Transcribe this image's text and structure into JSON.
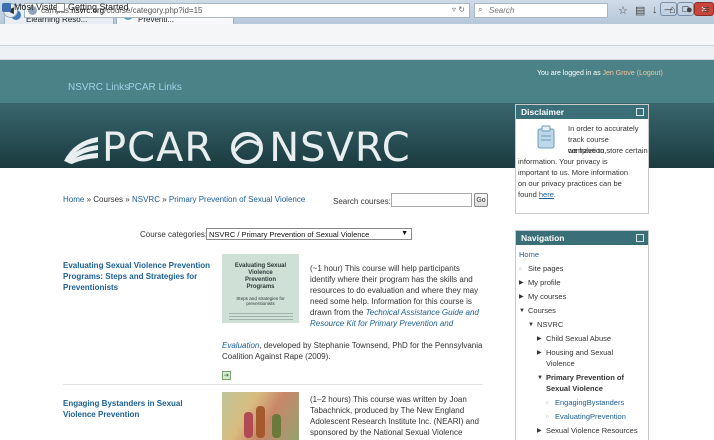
{
  "browser": {
    "tabs": [
      {
        "title": "Browse the Elearning Reso...",
        "close": "×"
      },
      {
        "title": "Campus: Primary Preventi...",
        "close": "×"
      }
    ],
    "new_tab": "+",
    "url_prefix": "campus.",
    "url_host": "nsvrc.org",
    "url_path": "/course/category.php?id=15",
    "search_placeholder": "Search",
    "bookmarks": [
      "Most Visited",
      "Getting Started"
    ]
  },
  "site": {
    "top_links": [
      "NSVRC Links",
      "PCAR Links"
    ],
    "logged_in_prefix": "You are logged in as ",
    "user": "Jen Grove",
    "logout": "(Logout)",
    "logo_left": "PCAR",
    "logo_right": "NSVRC"
  },
  "breadcrumb": [
    "Home",
    "Courses",
    "NSVRC",
    "Primary Prevention of Sexual Violence"
  ],
  "breadcrumb_sep": "»",
  "search": {
    "label": "Search courses:",
    "go": "Go"
  },
  "category": {
    "label": "Course categories:",
    "selected": "NSVRC / Primary Prevention of Sexual Violence"
  },
  "courses": [
    {
      "title": "Evaluating Sexual Violence Prevention Programs: Steps and Strategies for Preventionists",
      "thumb_title": "Evaluating Sexual Violence Prevention Programs",
      "thumb_subtitle": "Steps and strategies for preventionists",
      "desc_lines": [
        "(~1 hour)  This course will help participants",
        "identify where their program has the skills and",
        "resources to do evaluation and where they may",
        "need some help.  Information for this course is",
        "drawn from the"
      ],
      "desc_link1": "Technical Assistance Guide and",
      "desc_link2": "Resource Kit for Primary Prevention and",
      "desc_link3": "Evaluation",
      "desc_end1": ", developed by Stephanie Townsend, PhD for the Pennsylvania",
      "desc_end2": "Coalition Against Rape (2009)."
    },
    {
      "title": "Engaging Bystanders in Sexual Violence Prevention",
      "desc_lines": [
        "(1–2 hours) This course was written by Joan",
        "Tabachnick, produced by The New England",
        "Adolescent Research Institute Inc. (NEARI) and",
        "sponsored by the National Sexual Violence"
      ]
    }
  ],
  "disclaimer": {
    "title": "Disclaimer",
    "lines": [
      "In order to accurately",
      "track course completion,",
      "we have to store certain",
      "information. Your privacy is",
      "important to us. More information",
      "on our privacy practices can be"
    ],
    "found": "found ",
    "here": "here",
    "period": "."
  },
  "navigation": {
    "title": "Navigation",
    "items": [
      "Home",
      "Site pages",
      "My profile",
      "My courses",
      "Courses",
      "NSVRC",
      "Child Sexual Abuse",
      "Housing and Sexual",
      "Violence",
      "Primary Prevention of",
      "Sexual Violence",
      "EngagingBystanders",
      "EvaluatingPrevention",
      "Sexual Violence Resources"
    ],
    "bullets": {
      "square": "▫",
      "right": "▶",
      "down": "▼"
    }
  },
  "colors": {
    "teal": "#4b8287",
    "banner": "#2b5258",
    "link": "#1c6094",
    "block_head": "#3a6f78"
  }
}
